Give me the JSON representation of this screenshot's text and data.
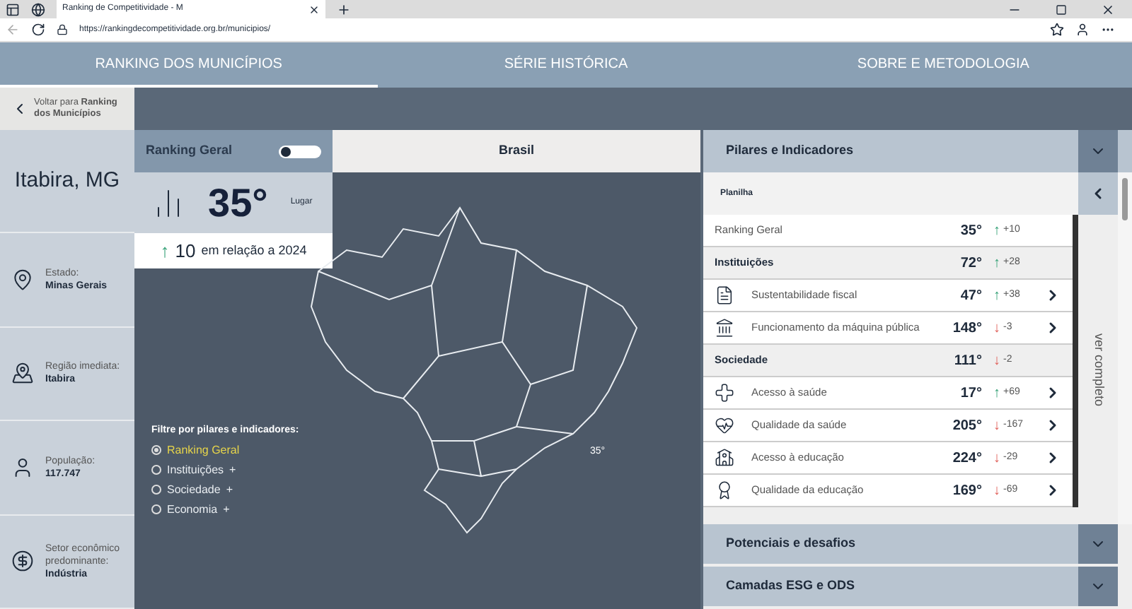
{
  "browser": {
    "tab_title": "Ranking de Competitividade - M",
    "url": "https://rankingdecompetitividade.org.br/municipios/"
  },
  "nav": [
    {
      "label": "RANKING DOS MUNICÍPIOS",
      "selected": true
    },
    {
      "label": "SÉRIE HISTÓRICA",
      "selected": false
    },
    {
      "label": "SOBRE E METODOLOGIA",
      "selected": false
    }
  ],
  "back_link": "Voltar para **Ranking dos Municípios**",
  "city": "Itabira, MG",
  "info": [
    {
      "label": "Estado:",
      "value": "Minas Gerais"
    },
    {
      "label": "Região imediata:",
      "value": "Itabira"
    },
    {
      "label": "População:",
      "value": "117.747"
    },
    {
      "label": "Setor econômico predominante:",
      "value": "Indústria"
    }
  ],
  "ranking_card": {
    "title": "Ranking Geral",
    "position": "35°",
    "position_label": "Lugar",
    "arrow": "↑",
    "change": "10",
    "change_label": "em relação a 2024"
  },
  "map": {
    "title": "Brasil",
    "marker": "35°"
  },
  "filter": {
    "title": "Filtre por pilares e indicadores:",
    "options": [
      {
        "label": "Ranking Geral",
        "selected": true
      },
      {
        "label": "Instituições",
        "selected": false,
        "suffix": "+"
      },
      {
        "label": "Sociedade",
        "selected": false,
        "suffix": "+"
      },
      {
        "label": "Economia",
        "selected": false,
        "suffix": "+"
      }
    ]
  },
  "panel": {
    "title": "Pilares e Indicadores",
    "subtitle": "Planilha",
    "side_label": "ver completo",
    "rows": [
      {
        "kind": "total",
        "label": "Ranking Geral",
        "position": "35°",
        "arrow": "↑",
        "change": "+10"
      },
      {
        "kind": "section",
        "label": "Instituições",
        "position": "72°",
        "arrow": "↑",
        "change": "+28"
      },
      {
        "kind": "indicator",
        "label": "Sustentabilidade fiscal",
        "position": "47°",
        "arrow": "↑",
        "change": "+38"
      },
      {
        "kind": "indicator",
        "label": "Funcionamento da máquina pública",
        "position": "148°",
        "arrow": "↓",
        "change": "-3"
      },
      {
        "kind": "section",
        "label": "Sociedade",
        "position": "111°",
        "arrow": "↓",
        "change": "-2"
      },
      {
        "kind": "indicator",
        "label": "Acesso à saúde",
        "position": "17°",
        "arrow": "↑",
        "change": "+69"
      },
      {
        "kind": "indicator",
        "label": "Qualidade da saúde",
        "position": "205°",
        "arrow": "↓",
        "change": "-167"
      },
      {
        "kind": "indicator",
        "label": "Acesso à educação",
        "position": "224°",
        "arrow": "↓",
        "change": "-29"
      },
      {
        "kind": "indicator",
        "label": "Qualidade da educação",
        "position": "169°",
        "arrow": "↓",
        "change": "-69"
      }
    ]
  },
  "sections": [
    {
      "label": "Potenciais e desafios"
    },
    {
      "label": "Camadas ESG e ODS"
    }
  ]
}
